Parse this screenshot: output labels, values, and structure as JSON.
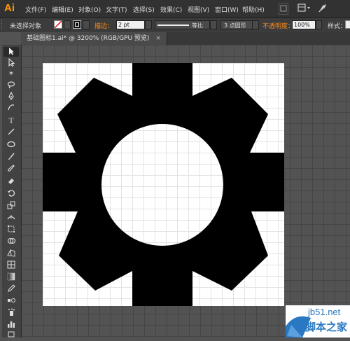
{
  "app": {
    "logo": "Ai"
  },
  "menu": [
    "文件(F)",
    "编辑(E)",
    "对象(O)",
    "文字(T)",
    "选择(S)",
    "效果(C)",
    "视图(V)",
    "窗口(W)",
    "帮助(H)"
  ],
  "options": {
    "selection_status": "未选择对象",
    "stroke_label": "描边：",
    "stroke_weight": "2 pt",
    "profile_label": "等比",
    "brush_label": "3 点圆形",
    "opacity_label": "不透明度：",
    "opacity_value": "100%",
    "style_label": "样式："
  },
  "document": {
    "tab_title": "基础图标1.ai* @ 3200% (RGB/GPU 预览)"
  },
  "watermark": {
    "site": "jb51.net",
    "name": "脚本之家"
  },
  "colors": {
    "accent": "#ff9a00",
    "opacity_label": "#ff8c1a",
    "ui_bg": "#535353",
    "gear": "#000000",
    "artboard": "#ffffff"
  },
  "tools": [
    "selection-tool",
    "direct-selection-tool",
    "magic-wand-tool",
    "lasso-tool",
    "pen-tool",
    "curvature-tool",
    "type-tool",
    "line-tool",
    "ellipse-tool",
    "paintbrush-tool",
    "pencil-tool",
    "eraser-tool",
    "rotate-tool",
    "scale-tool",
    "width-tool",
    "free-transform-tool",
    "shape-builder-tool",
    "perspective-grid-tool",
    "mesh-tool",
    "gradient-tool",
    "eyedropper-tool",
    "blend-tool",
    "symbol-sprayer-tool",
    "column-graph-tool",
    "artboard-tool"
  ]
}
